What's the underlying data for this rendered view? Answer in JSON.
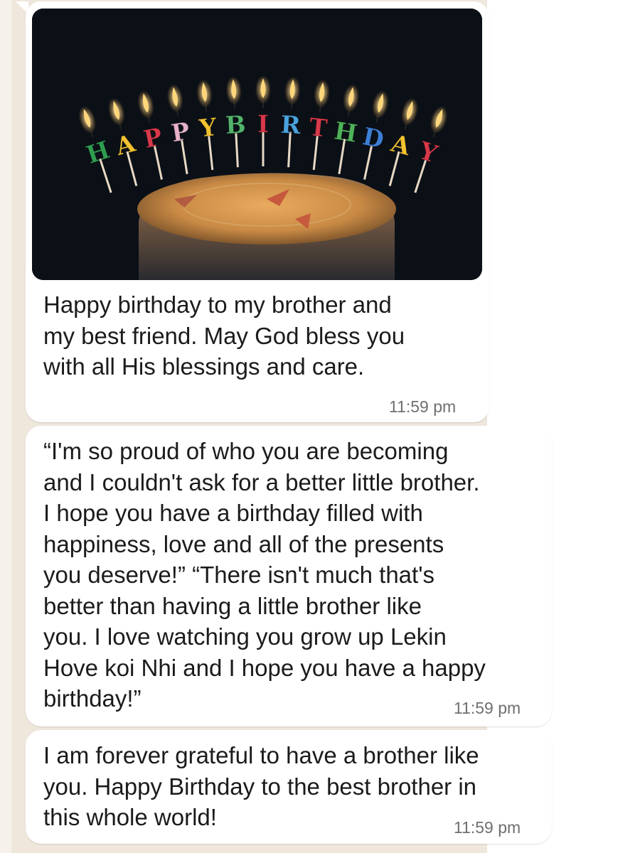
{
  "chat": {
    "messages": [
      {
        "image": {
          "alt": "",
          "candle_letters": [
            "H",
            "A",
            "P",
            "P",
            "Y",
            "B",
            "I",
            "R",
            "T",
            "H",
            "D",
            "A",
            "Y"
          ]
        },
        "text": "Happy birthday to my brother and\nmy best friend. May God bless you\nwith all His blessings and care.",
        "time": "11:59 pm"
      },
      {
        "text": "“I'm so proud of who you are becoming\nand I couldn't ask for a better little brother.\nI hope you have a birthday filled with\nhappiness, love and all of the presents\nyou deserve!” “There isn't much that's\nbetter than having a little brother like\nyou. I love watching you grow up Lekin\nHove koi Nhi and I hope you have a happy\nbirthday!”",
        "time": "11:59 pm"
      },
      {
        "text": "I am forever grateful to have a brother like\nyou. Happy Birthday to the best brother in\nthis whole world!",
        "time": "11:59 pm"
      }
    ]
  },
  "colors": {
    "chat_background": "#efe7dc",
    "bubble": "#ffffff",
    "timestamp": "#6f6f6f",
    "candle_colors": [
      "#2e9e4f",
      "#f2c230",
      "#d8394a",
      "#e7b1c8",
      "#f2c230",
      "#52b36b",
      "#d8394a",
      "#4aa3df",
      "#d8394a",
      "#4fb35a",
      "#3d7fd6",
      "#f2c230",
      "#d8394a"
    ]
  }
}
